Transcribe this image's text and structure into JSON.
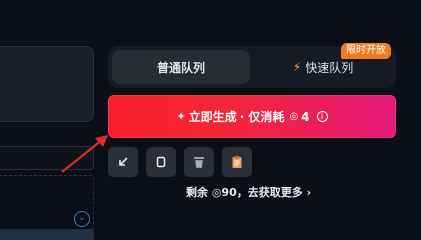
{
  "queue": {
    "tabs": [
      {
        "label": "普通队列",
        "active": true
      },
      {
        "label": "快速队列",
        "active": false
      }
    ],
    "badge": "限时开放"
  },
  "generate": {
    "label": "立即生成",
    "cost_prefix": "· 仅消耗",
    "cost": "4"
  },
  "tools": [
    {
      "icon": "collapse-arrow-icon"
    },
    {
      "icon": "copy-icon"
    },
    {
      "icon": "trash-icon"
    },
    {
      "icon": "clipboard-icon"
    }
  ],
  "remaining": {
    "text": "剩余 ◎90，去获取更多",
    "arrow": "›"
  },
  "colors": {
    "accent_red": "#f8202c",
    "accent_pink": "#e3197a",
    "badge_orange": "#f07b21",
    "annotation_arrow": "#e02a2a"
  }
}
